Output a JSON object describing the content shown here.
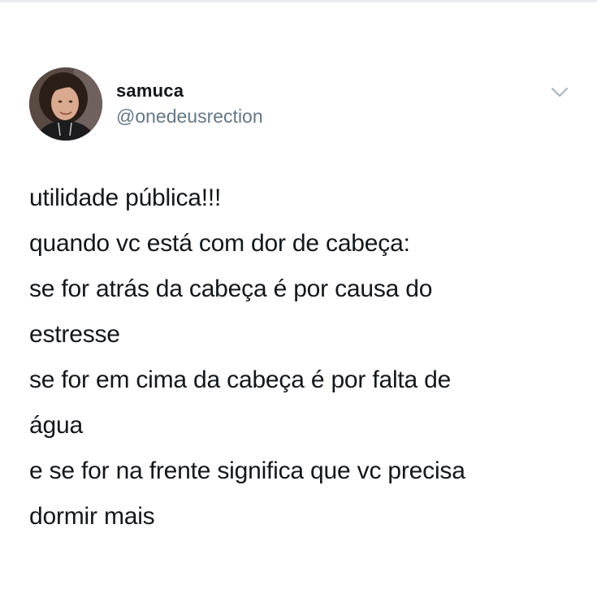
{
  "tweet": {
    "author": {
      "display_name": "samuca",
      "handle": "@onedeusrection",
      "avatar_icon": "profile-photo"
    },
    "menu_icon": "chevron-down-icon",
    "lines": [
      "utilidade pública!!!",
      "quando vc está com dor de cabeça:",
      "se for atrás da cabeça é por causa do",
      "estresse",
      "se for em cima da cabeça é por falta de",
      "água",
      "e se for na frente significa que vc precisa",
      "dormir mais"
    ]
  },
  "colors": {
    "text": "#14171a",
    "secondary_text": "#657786",
    "chevron": "#aab8c2",
    "background": "#ffffff"
  }
}
